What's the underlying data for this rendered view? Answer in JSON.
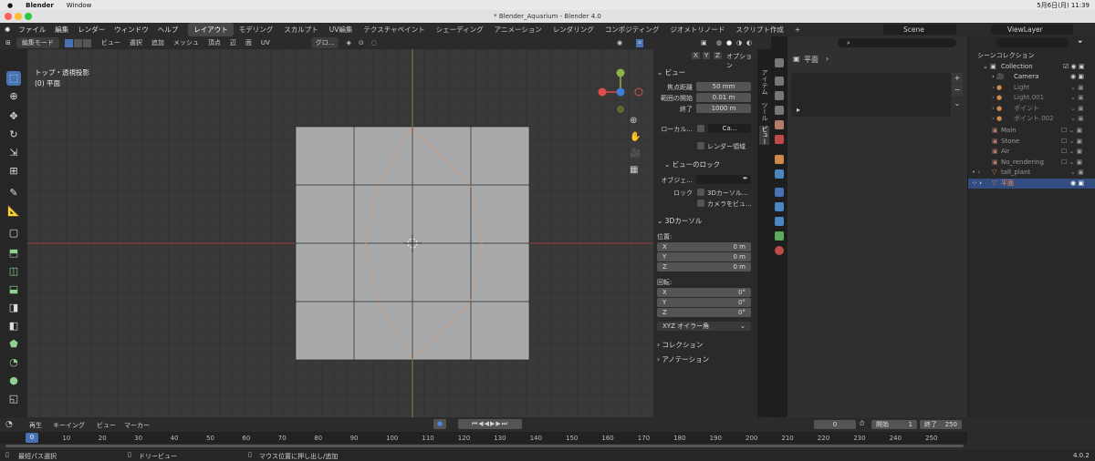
{
  "mac_menubar": {
    "apple": "",
    "app": "Blender",
    "window": "Window",
    "clock": "5月6日(月) 11:39"
  },
  "window_title": "* Blender_Aquarium - Blender 4.0",
  "top_menu": [
    "ファイル",
    "編集",
    "レンダー",
    "ウィンドウ",
    "ヘルプ"
  ],
  "workspaces": [
    "レイアウト",
    "モデリング",
    "スカルプト",
    "UV編集",
    "テクスチャペイント",
    "シェーディング",
    "アニメーション",
    "レンダリング",
    "コンポジティング",
    "ジオメトリノード",
    "スクリプト作成"
  ],
  "workspace_add": "+",
  "scene_name": "Scene",
  "view_layer": "ViewLayer",
  "viewport_header": {
    "mode": "編集モード",
    "menus": [
      "ビュー",
      "選択",
      "追加",
      "メッシュ",
      "頂点",
      "辺",
      "面",
      "UV"
    ],
    "orientation": "グロ...",
    "options": "オプション",
    "axes": [
      "X",
      "Y",
      "Z"
    ]
  },
  "viewport_overlay": {
    "view_name": "トップ・透視投影",
    "object_name": "(0) 平面"
  },
  "npanel": {
    "view_header": "ビュー",
    "focal_label": "焦点距離",
    "focal_value": "50 mm",
    "clip_start_label": "範囲の開始",
    "clip_start_value": "0.01 m",
    "clip_end_label": "終了",
    "clip_end_value": "1000 m",
    "local_camera_label": "ローカル...",
    "local_camera_value": "Ca...",
    "render_region_label": "レンダー領域",
    "view_lock_header": "ビューのロック",
    "lock_object_label": "オブジェ...",
    "lock_label": "ロック",
    "lock_3dcursor": "3Dカーソル...",
    "lock_camera": "カメラをビュ...",
    "cursor_header": "3Dカーソル",
    "location_label": "位置:",
    "loc": [
      {
        "axis": "X",
        "value": "0 m"
      },
      {
        "axis": "Y",
        "value": "0 m"
      },
      {
        "axis": "Z",
        "value": "0 m"
      }
    ],
    "rotation_label": "回転:",
    "rot": [
      {
        "axis": "X",
        "value": "0°"
      },
      {
        "axis": "Y",
        "value": "0°"
      },
      {
        "axis": "Z",
        "value": "0°"
      }
    ],
    "rotation_mode": "XYZ オイラー角",
    "collection_header": "コレクション",
    "annotation_header": "アノテーション",
    "tabs": [
      "アイテム",
      "ツール",
      "ビュー"
    ]
  },
  "properties": {
    "breadcrumb": "平面"
  },
  "outliner": {
    "root": "シーンコレクション",
    "rows": [
      {
        "name": "Collection",
        "level": 1
      },
      {
        "name": "Camera",
        "level": 2
      },
      {
        "name": "Light",
        "level": 2
      },
      {
        "name": "Light.001",
        "level": 2
      },
      {
        "name": "ポイント",
        "level": 2
      },
      {
        "name": "ポイント.002",
        "level": 2
      },
      {
        "name": "Main",
        "level": 1
      },
      {
        "name": "Stone",
        "level": 1
      },
      {
        "name": "Air",
        "level": 1
      },
      {
        "name": "No_rendering",
        "level": 1
      },
      {
        "name": "tall_plant",
        "level": 1
      },
      {
        "name": "平面",
        "level": 1
      }
    ]
  },
  "timeline": {
    "menus": [
      "再生",
      "キーイング",
      "ビュー",
      "マーカー"
    ],
    "current_frame": "0",
    "start_label": "開始",
    "start": "1",
    "end_label": "終了",
    "end": "250",
    "ticks": [
      "0",
      "10",
      "20",
      "30",
      "40",
      "50",
      "60",
      "70",
      "80",
      "90",
      "100",
      "110",
      "120",
      "130",
      "140",
      "150",
      "160",
      "170",
      "180",
      "190",
      "200",
      "210",
      "220",
      "230",
      "240",
      "250"
    ],
    "playhead": "0"
  },
  "statusbar": {
    "left": "最短パス選択",
    "middle": "ドリービュー",
    "right": "マウス位置に押し出し/追加",
    "version": "4.0.2"
  },
  "colors": {
    "accent": "#4772b3",
    "x_axis": "#e04c4c",
    "y_axis": "#8cb34a",
    "z_axis": "#3e7fd8",
    "selection": "#e8935a"
  }
}
